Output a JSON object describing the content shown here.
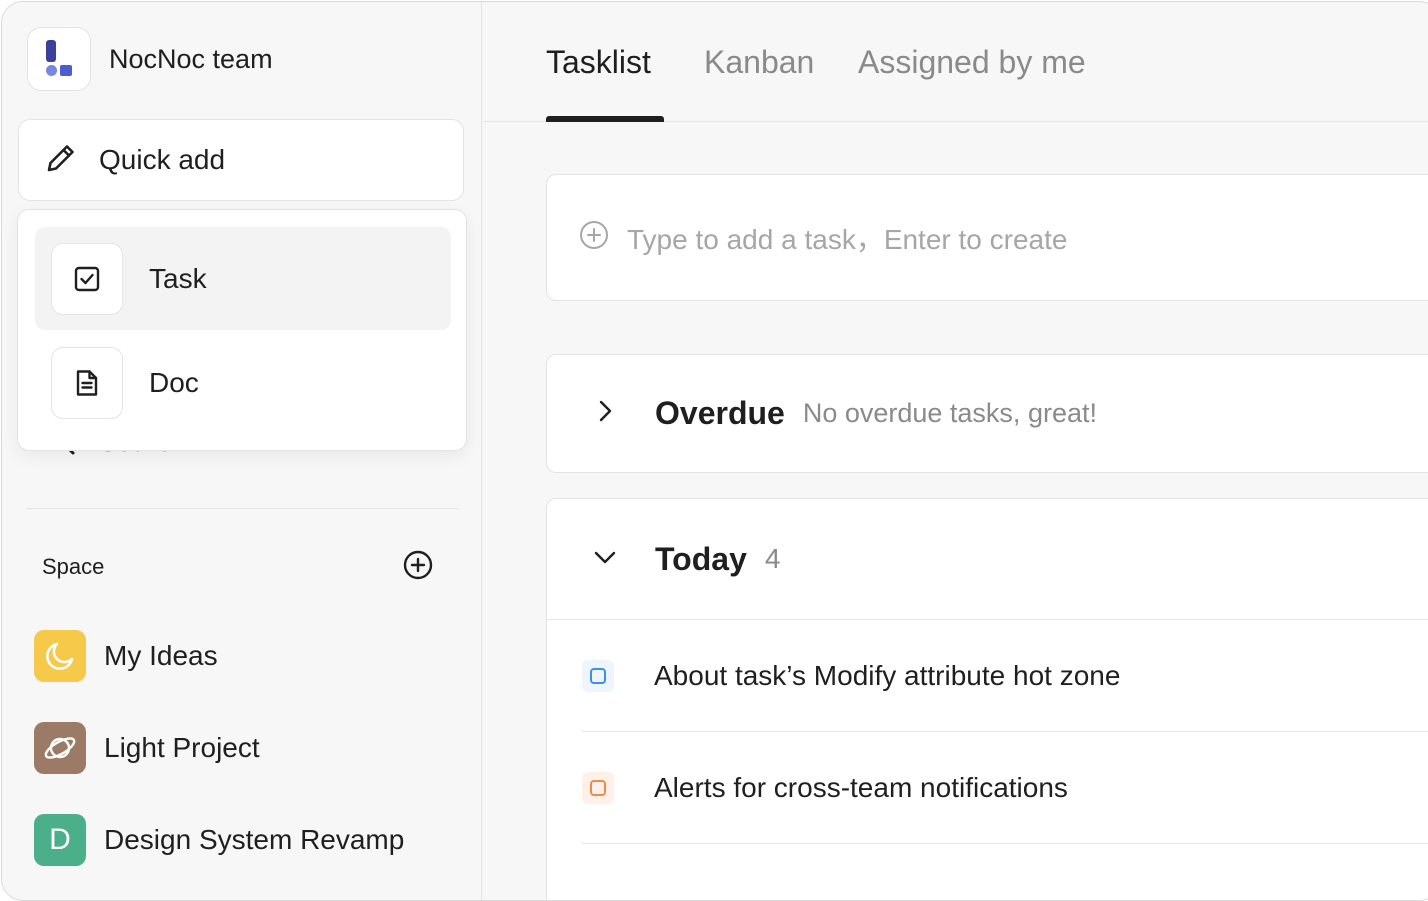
{
  "team": {
    "name": "NocNoc team"
  },
  "quick_add": {
    "label": "Quick add"
  },
  "quick_add_menu": [
    {
      "label": "Task",
      "icon": "checkbox-icon"
    },
    {
      "label": "Doc",
      "icon": "document-icon"
    }
  ],
  "search": {
    "label": "Search"
  },
  "space": {
    "label": "Space",
    "items": [
      {
        "label": "My Ideas",
        "icon": "moon-icon",
        "color": "#f7c94a"
      },
      {
        "label": "Light Project",
        "icon": "planet-icon",
        "color": "#9b7b66"
      },
      {
        "label": "Design System Revamp",
        "icon": "letter-d-icon",
        "letter": "D",
        "color": "#4bb08a"
      }
    ]
  },
  "tabs": [
    {
      "label": "Tasklist",
      "active": true
    },
    {
      "label": "Kanban",
      "active": false
    },
    {
      "label": "Assigned by me",
      "active": false
    }
  ],
  "add_task": {
    "placeholder": "Type to add a task，Enter to create"
  },
  "overdue": {
    "title": "Overdue",
    "note": "No overdue tasks, great!"
  },
  "today": {
    "title": "Today",
    "count": "4",
    "tasks": [
      {
        "label": "About task’s Modify attribute hot zone",
        "color": "#3d8ef0"
      },
      {
        "label": "Alerts for cross-team notifications",
        "color": "#f08a4b"
      }
    ]
  }
}
